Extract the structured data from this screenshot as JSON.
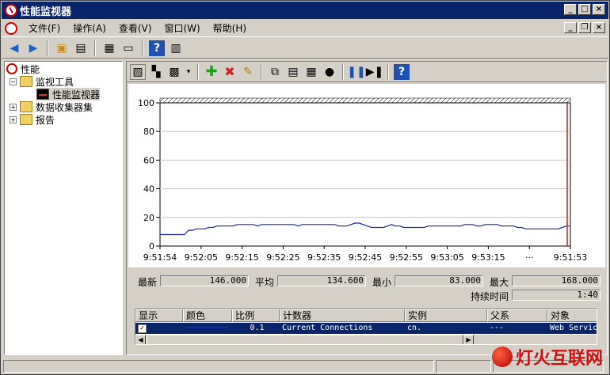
{
  "window": {
    "title": "性能监视器"
  },
  "menu": [
    "文件(F)",
    "操作(A)",
    "查看(V)",
    "窗口(W)",
    "帮助(H)"
  ],
  "tree": {
    "root": "性能",
    "items": [
      "监视工具",
      "性能监视器",
      "数据收集器集",
      "报告"
    ]
  },
  "stats": {
    "last_label": "最新",
    "last_value": "146.000",
    "avg_label": "平均",
    "avg_value": "134.600",
    "min_label": "最小",
    "min_value": "83.000",
    "max_label": "最大",
    "max_value": "168.000",
    "duration_label": "持续时间",
    "duration_value": "1:40"
  },
  "legend": {
    "columns": [
      "显示",
      "颜色",
      "比例",
      "计数器",
      "实例",
      "父系",
      "对象"
    ],
    "row": {
      "scale": "0.1",
      "counter": "Current Connections",
      "instance": "cn.",
      "parent": "---",
      "object": "Web Servic"
    }
  },
  "colors": {
    "title_bg": "#0a246a",
    "series": "#1a2a9a",
    "time_bar": "#cc2020",
    "watermark": "#d01010"
  },
  "watermark": {
    "text": "灯火互联网"
  },
  "chart_data": {
    "type": "line",
    "ylim": [
      0,
      100
    ],
    "yticks": [
      "100",
      "80",
      "60",
      "40",
      "20",
      "0"
    ],
    "xticks": [
      "9:51:54",
      "9:52:05",
      "9:52:15",
      "9:52:25",
      "9:52:35",
      "9:52:45",
      "9:52:55",
      "9:53:05",
      "9:53:15",
      "···",
      "9:51:53"
    ],
    "series": [
      {
        "values": [
          8,
          8,
          8,
          8,
          8,
          8,
          8,
          11,
          11,
          12,
          12,
          12,
          13,
          13,
          14,
          14,
          14,
          14,
          14,
          15,
          15,
          15,
          15,
          15,
          14,
          15,
          15,
          15,
          15,
          15,
          15,
          15,
          15,
          15,
          14,
          15,
          15,
          15,
          15,
          15,
          15,
          15,
          15,
          15,
          14,
          14,
          14,
          15,
          16,
          16,
          15,
          14,
          13,
          13,
          13,
          13,
          14,
          15,
          14,
          14,
          13,
          13,
          13,
          13,
          13,
          13,
          14,
          14,
          14,
          14,
          14,
          14,
          14,
          14,
          14,
          15,
          15,
          15,
          14,
          14,
          15,
          15,
          15,
          15,
          14,
          14,
          14,
          14,
          13,
          13,
          12,
          12,
          12,
          12,
          12,
          12,
          12,
          12,
          12,
          13,
          14,
          14
        ]
      }
    ]
  }
}
